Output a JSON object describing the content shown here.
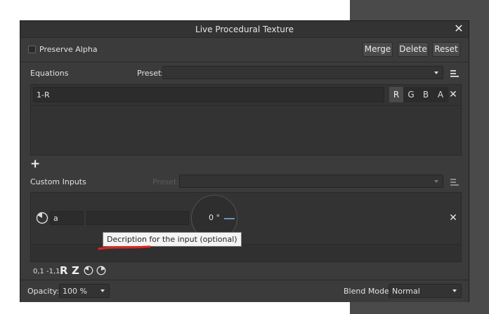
{
  "dialog": {
    "title": "Live Procedural Texture",
    "preserve_alpha_label": "Preserve Alpha",
    "merge_label": "Merge",
    "delete_label": "Delete",
    "reset_label": "Reset"
  },
  "equations": {
    "label": "Equations",
    "preset_label": "Preset:",
    "preset_value": "",
    "entry_value": "1-R",
    "channels": [
      "R",
      "G",
      "B",
      "A"
    ],
    "active_channel": "R"
  },
  "custom_inputs": {
    "label": "Custom Inputs",
    "preset_label": "Preset:",
    "preset_value": "",
    "input_name": "a",
    "input_description": "",
    "dial_value": "0 °",
    "tooltip": "Decription for the input (optional)"
  },
  "input_toolbar": {
    "unit_range": "0,1",
    "signed_range": "-1,1",
    "random_label": "R",
    "z_label": "Z"
  },
  "footer": {
    "opacity_label": "Opacity:",
    "opacity_value": "100 %",
    "blend_label": "Blend Mode:",
    "blend_value": "Normal"
  }
}
